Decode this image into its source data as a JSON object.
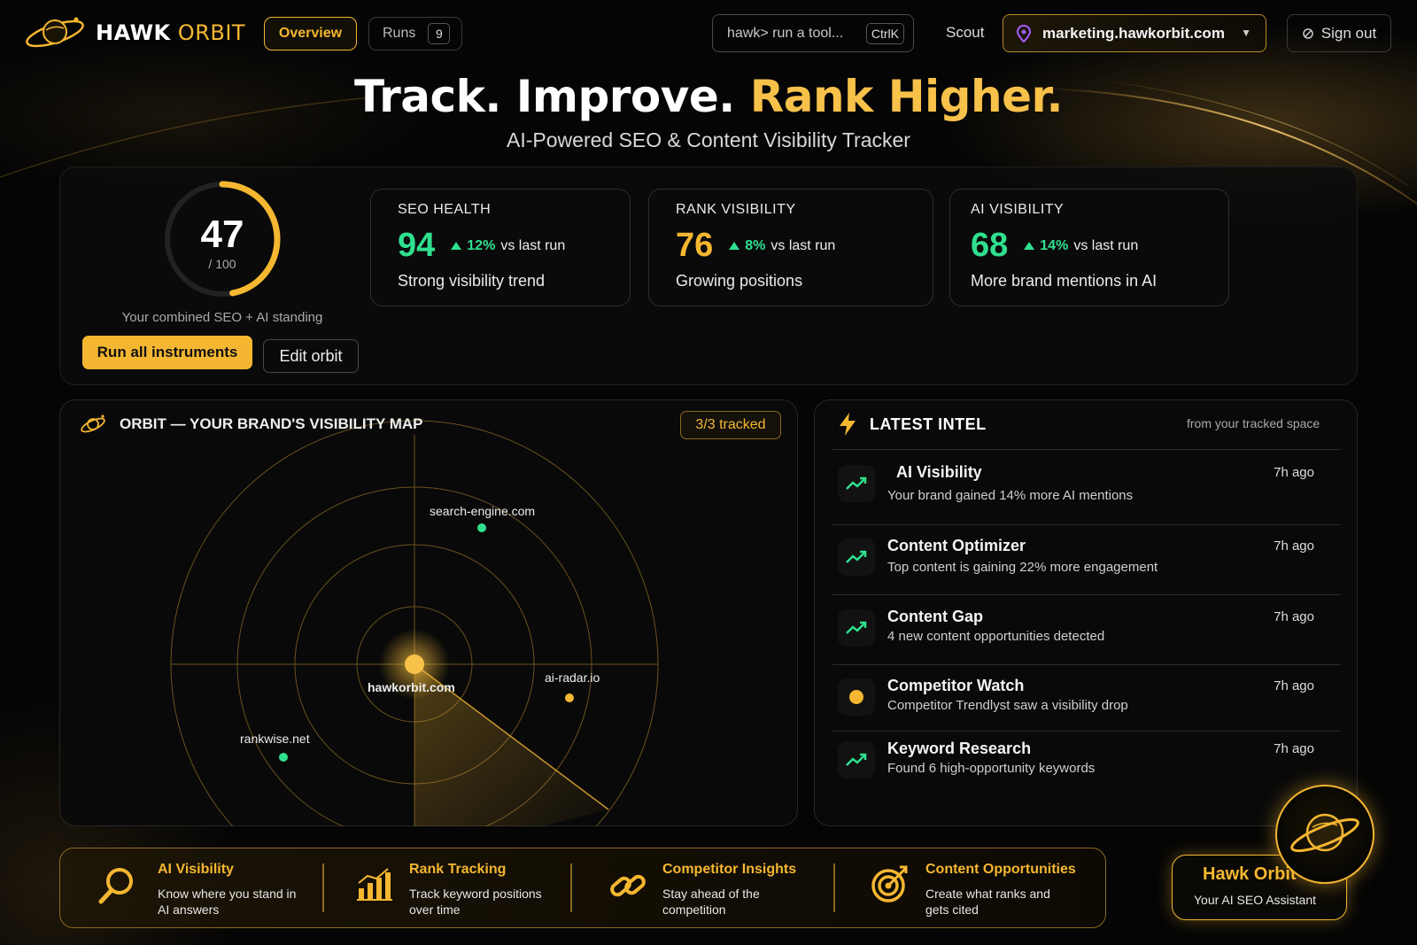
{
  "brand": {
    "name_bold": "HAWK",
    "name_light": "ORBIT"
  },
  "nav": {
    "overview_label": "Overview",
    "runs_label": "Runs",
    "runs_count": "9"
  },
  "command": {
    "placeholder": "hawk> run a tool...",
    "shortcut": "CtrlK"
  },
  "scout_label": "Scout",
  "domain_select": {
    "value": "marketing.hawkorbit.com"
  },
  "signout_label": "Sign out",
  "hero": {
    "title_part1": "Track. Improve.",
    "title_part2": "Rank Higher.",
    "subtitle": "AI-Powered SEO & Content Visibility Tracker"
  },
  "score": {
    "value": "47",
    "max_label": "/ 100",
    "fraction": 0.47,
    "caption": "Your combined SEO + AI standing",
    "run_button": "Run all instruments",
    "edit_button": "Edit orbit"
  },
  "metrics": [
    {
      "label": "SEO HEALTH",
      "value": "94",
      "delta": "12%",
      "delta_suffix": "vs last run",
      "desc": "Strong visibility trend"
    },
    {
      "label": "RANK VISIBILITY",
      "value": "76",
      "delta": "8%",
      "delta_suffix": "vs last run",
      "desc": "Growing positions"
    },
    {
      "label": "AI VISIBILITY",
      "value": "68",
      "delta": "14%",
      "delta_suffix": "vs last run",
      "desc": "More brand mentions in AI"
    }
  ],
  "orbit": {
    "title": "ORBIT — YOUR BRAND'S VISIBILITY MAP",
    "tracked": "3/3 tracked",
    "center_label": "hawkorbit.com",
    "competitors": [
      {
        "label": "search-engine.com",
        "color": "#2fe08f"
      },
      {
        "label": "ai-radar.io",
        "color": "#f5b731"
      },
      {
        "label": "rankwise.net",
        "color": "#2fe08f"
      }
    ]
  },
  "intel": {
    "title": "LATEST INTEL",
    "subtitle": "from your tracked space",
    "items": [
      {
        "title": "AI Visibility",
        "desc": "Your brand gained 14% more AI mentions",
        "time": "7h ago",
        "icon": "trend-up-icon"
      },
      {
        "title": "Content Optimizer",
        "desc": "Top content is gaining 22% more engagement",
        "time": "7h ago",
        "icon": "trend-up-icon"
      },
      {
        "title": "Content Gap",
        "desc": "4 new content opportunities detected",
        "time": "7h ago",
        "icon": "trend-up-icon"
      },
      {
        "title": "Competitor Watch",
        "desc": "Competitor Trendlyst saw a visibility drop",
        "time": "7h ago",
        "icon": "dot-icon"
      },
      {
        "title": "Keyword Research",
        "desc": "Found 6 high-opportunity keywords",
        "time": "7h ago",
        "icon": "trend-up-icon"
      }
    ]
  },
  "features": [
    {
      "title": "AI Visibility",
      "desc": "Know where you stand in AI answers",
      "icon": "search-icon"
    },
    {
      "title": "Rank Tracking",
      "desc": "Track keyword positions over time",
      "icon": "bar-chart-icon"
    },
    {
      "title": "Competitor Insights",
      "desc": "Stay ahead of the competition",
      "icon": "link-icon"
    },
    {
      "title": "Content Opportunities",
      "desc": "Create what ranks and gets cited",
      "icon": "target-icon"
    }
  ],
  "assistant": {
    "name": "Hawk Orbit",
    "subtitle": "Your AI SEO Assistant"
  },
  "colors": {
    "accent": "#f5b731",
    "positive": "#2fe08f",
    "background": "#050505"
  }
}
